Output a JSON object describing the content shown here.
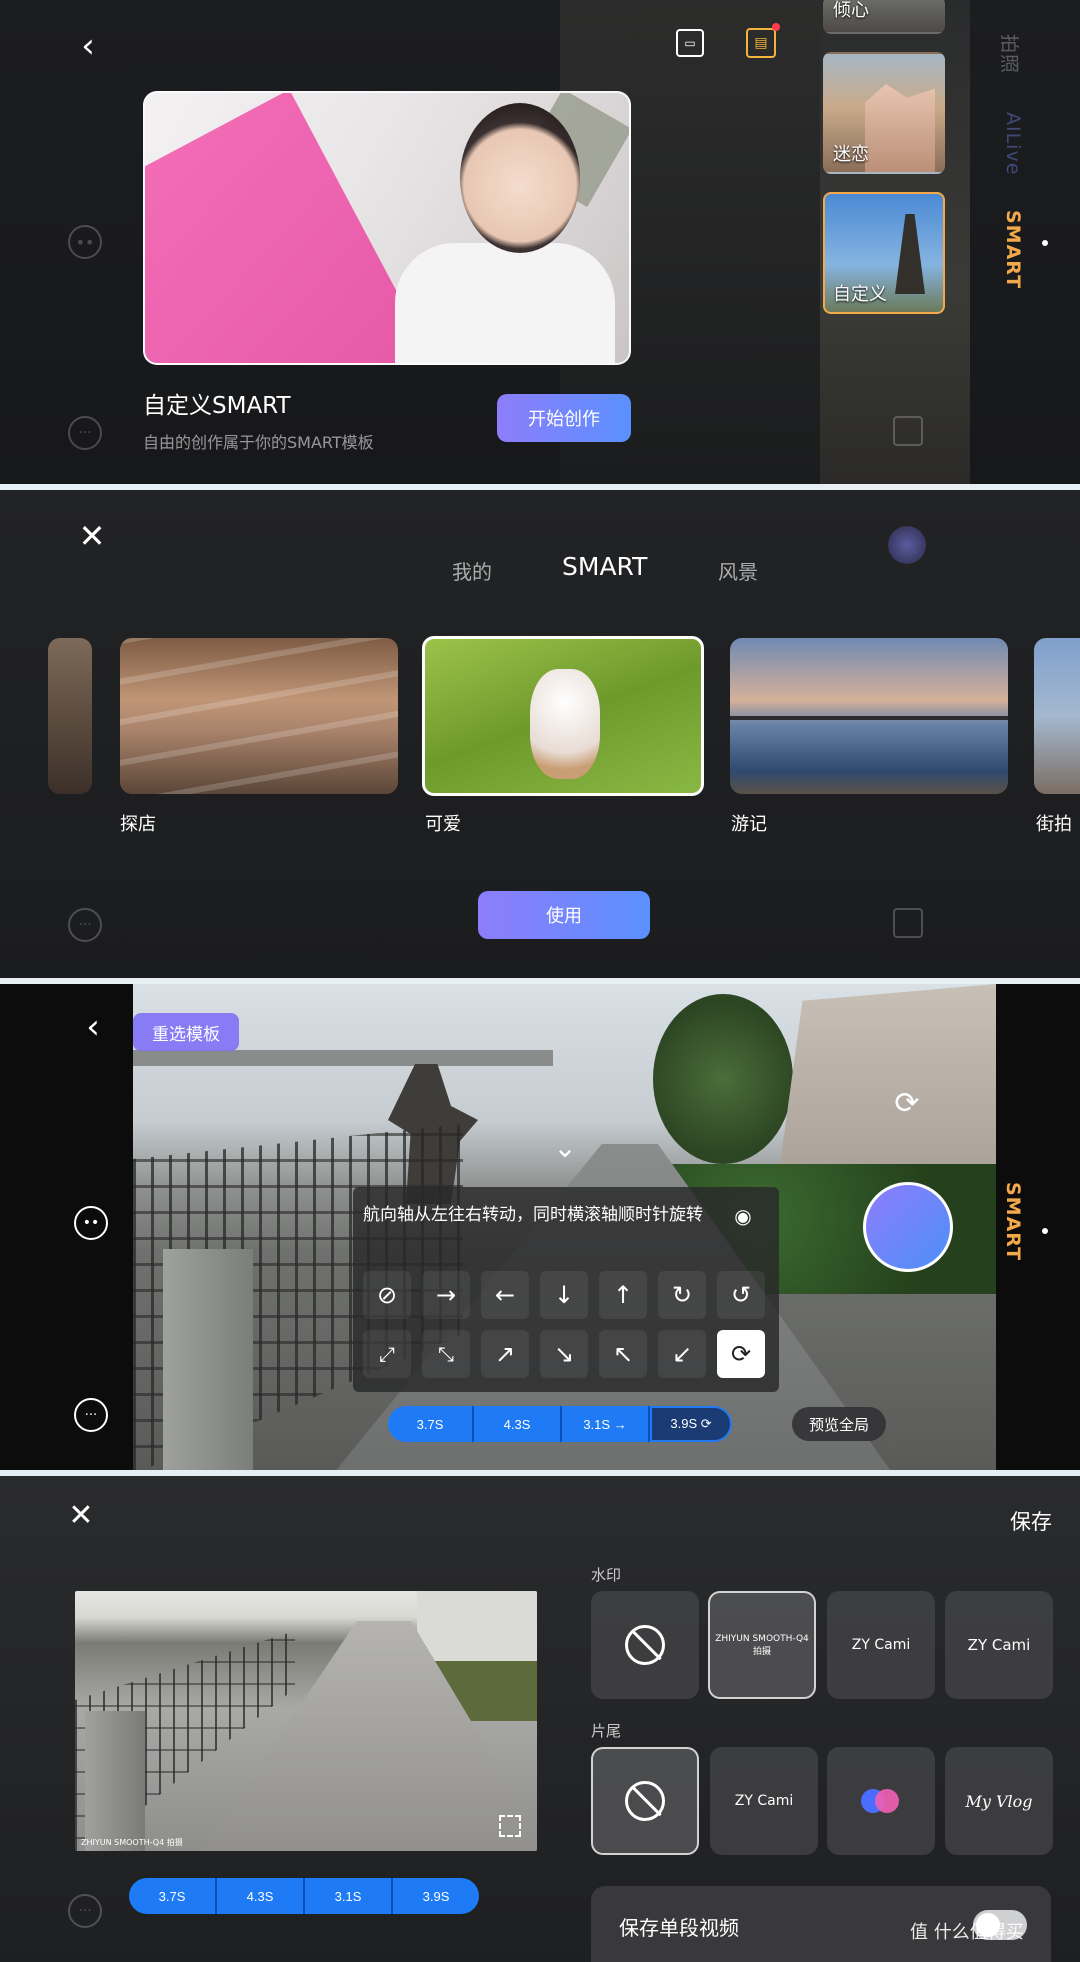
{
  "panel1": {
    "hero_title": "自定义SMART",
    "hero_subtitle": "自由的创作属于你的SMART模板",
    "start_button": "开始创作",
    "thumbnails": [
      "倾心",
      "迷恋",
      "自定义"
    ],
    "mode_tabs": [
      "拍照",
      "AILive",
      "SMART"
    ],
    "accent_color": "#f3a94a"
  },
  "panel2": {
    "tabs": [
      "我的",
      "SMART",
      "风景"
    ],
    "active_tab": "SMART",
    "cards": [
      "探店",
      "可爱",
      "游记",
      "街拍"
    ],
    "selected_card": "可爱",
    "use_button": "使用"
  },
  "panel3": {
    "reselect_button": "重选模板",
    "instruction": "航向轴从左往右转动，同时横滚轴顺时针旋转",
    "motion_icons_row1": [
      "no-motion",
      "arrow-right",
      "arrow-left",
      "arrow-down",
      "arrow-up",
      "rotate-cw",
      "rotate-ccw"
    ],
    "motion_icons_row2": [
      "expand",
      "shrink",
      "arrow-up-right",
      "arrow-down-right",
      "arrow-up-left",
      "arrow-down-left",
      "rotate-roll"
    ],
    "segments": [
      {
        "label": "3.7S"
      },
      {
        "label": "4.3S"
      },
      {
        "label": "3.1S →"
      },
      {
        "label": "3.9S ⟳"
      }
    ],
    "preview_all": "预览全局",
    "mode_label": "SMART"
  },
  "panel4": {
    "save_button": "保存",
    "watermark_label": "水印",
    "ending_label": "片尾",
    "watermark_options": [
      "",
      "ZHIYUN SMOOTH-Q4 拍摄",
      "ZY Cami",
      "ZY Cami"
    ],
    "ending_options": [
      "",
      "ZY Cami",
      "",
      "My Vlog"
    ],
    "video_watermark": "ZHIYUN SMOOTH-Q4 拍摄",
    "segments": [
      "3.7S",
      "4.3S",
      "3.1S",
      "3.9S"
    ],
    "save_single_label": "保存单段视频",
    "site_watermark": "值 什么值得买"
  }
}
